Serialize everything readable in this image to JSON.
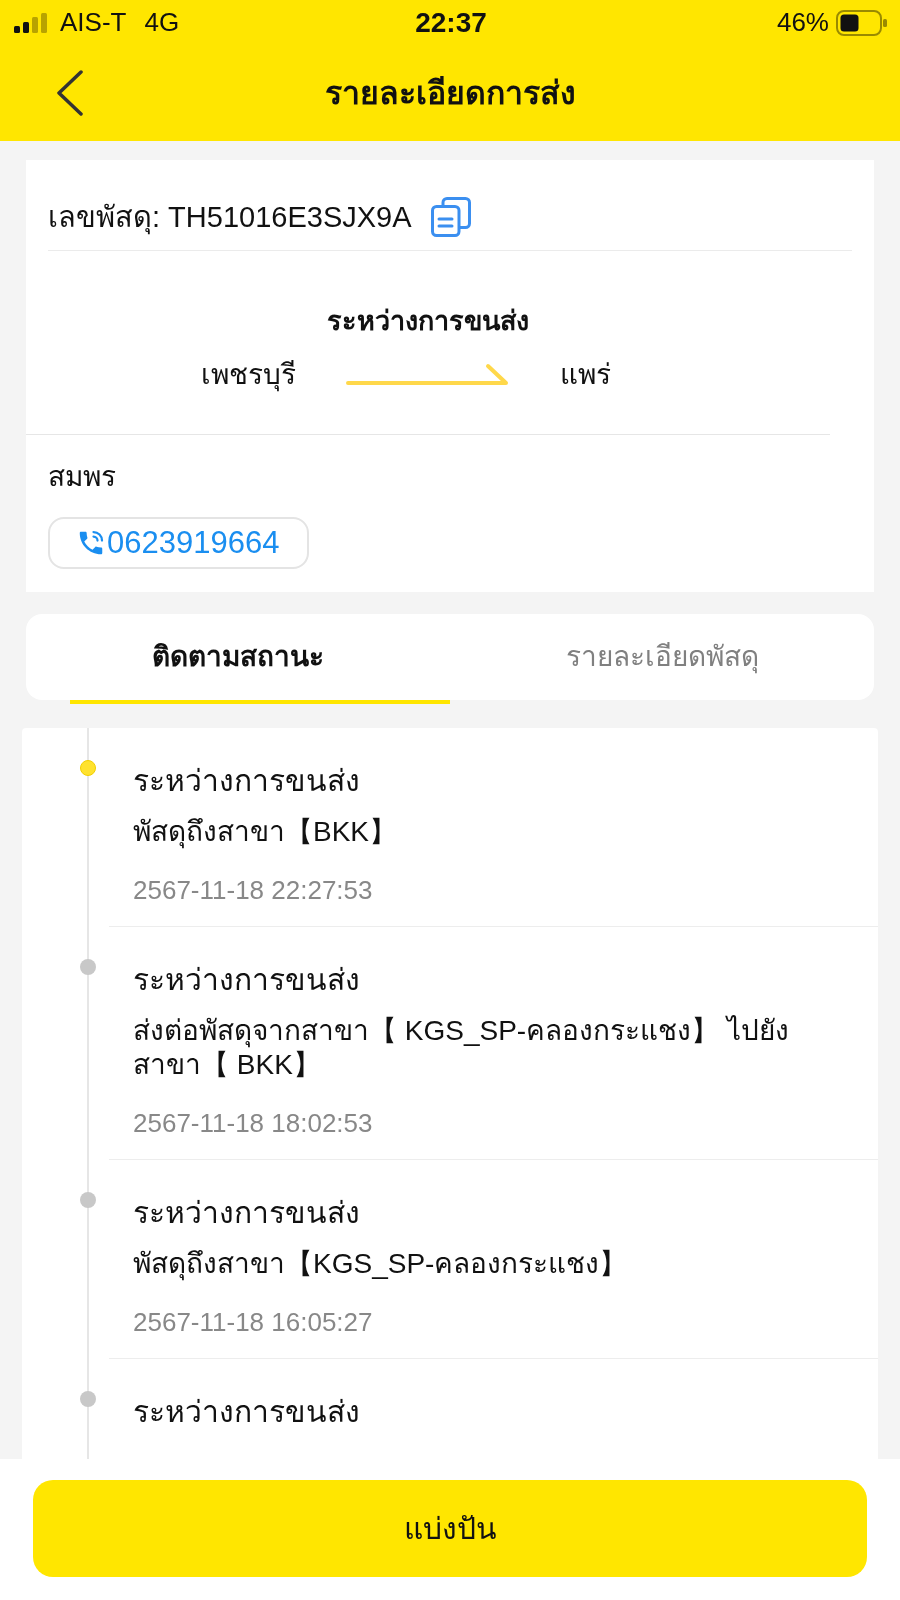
{
  "status_bar": {
    "carrier": "AIS-T",
    "network": "4G",
    "time": "22:37",
    "battery": "46%"
  },
  "header": {
    "title": "รายละเอียดการส่ง"
  },
  "parcel": {
    "tracking_number": "เลขพัสดุ: TH51016E3SJX9A",
    "status": "ระหว่างการขนส่ง",
    "origin": "เพชรบุรี",
    "destination": "แพร่",
    "recipient_name": "สมพร",
    "phone": "0623919664"
  },
  "tabs": [
    {
      "label": "ติดตามสถานะ",
      "selected": true
    },
    {
      "label": "รายละเอียดพัสดุ",
      "selected": false
    }
  ],
  "timeline": [
    {
      "title": "ระหว่างการขนส่ง",
      "description": "พัสดุถึงสาขา【BKK】",
      "time": "2567-11-18 22:27:53",
      "active": true
    },
    {
      "title": "ระหว่างการขนส่ง",
      "description": "ส่งต่อพัสดุจากสาขา【 KGS_SP-คลองกระแชง】 ไปยังสาขา【 BKK】",
      "time": "2567-11-18 18:02:53",
      "active": false
    },
    {
      "title": "ระหว่างการขนส่ง",
      "description": "พัสดุถึงสาขา【KGS_SP-คลองกระแชง】",
      "time": "2567-11-18 16:05:27",
      "active": false
    },
    {
      "title": "ระหว่างการขนส่ง",
      "active": false
    }
  ],
  "bottom_bar": {
    "button": "แบ่งปัน"
  }
}
